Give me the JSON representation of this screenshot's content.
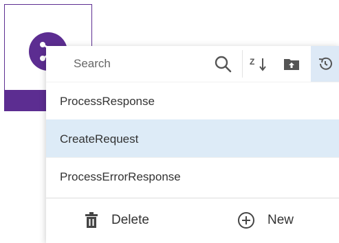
{
  "search": {
    "placeholder": "Search"
  },
  "toolbar": {
    "icons": [
      "search-icon",
      "sort-icon",
      "folder-upload-icon",
      "history-icon"
    ]
  },
  "list": {
    "items": [
      {
        "label": "ProcessResponse"
      },
      {
        "label": "CreateRequest"
      },
      {
        "label": "ProcessErrorResponse"
      }
    ]
  },
  "footer": {
    "delete_label": "Delete",
    "new_label": "New"
  },
  "colors": {
    "accent": "#5c2d91",
    "selected_row": "#ddebf7",
    "icon": "#555555"
  }
}
